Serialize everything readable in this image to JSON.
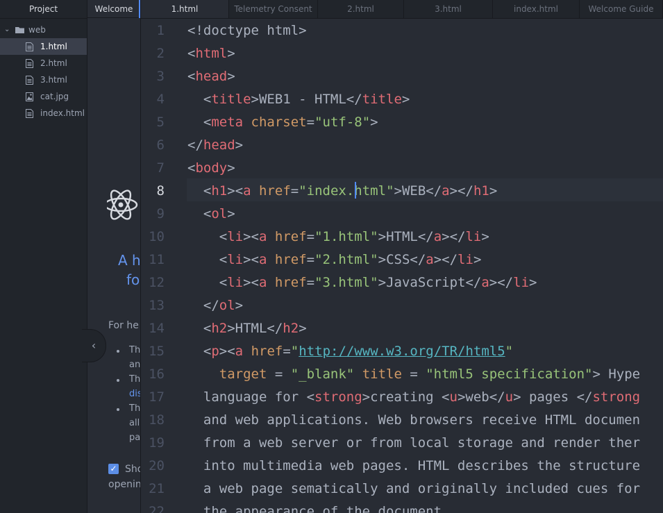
{
  "project": {
    "title": "Project",
    "folder": "web",
    "files": [
      "1.html",
      "2.html",
      "3.html",
      "cat.jpg",
      "index.html"
    ],
    "selected": "1.html"
  },
  "welcome": {
    "tab": "Welcome",
    "heading_1": "A h",
    "heading_2": "fo",
    "help": "For he",
    "items": [
      [
        "Th",
        "an"
      ],
      [
        "Th",
        "dis"
      ],
      [
        "Th",
        "all",
        "pa"
      ]
    ],
    "checkbox_label": "Sho",
    "checkbox_label_2": "openin"
  },
  "tabs": [
    "1.html",
    "Telemetry Consent",
    "2.html",
    "3.html",
    "index.html",
    "Welcome Guide"
  ],
  "active_tab": "1.html",
  "editor": {
    "current_line": 8,
    "lines": [
      [
        [
          "pn",
          "<!doctype html>"
        ]
      ],
      [
        [
          "pn",
          "<"
        ],
        [
          "tg",
          "html"
        ],
        [
          "pn",
          ">"
        ]
      ],
      [
        [
          "pn",
          "<"
        ],
        [
          "tg",
          "head"
        ],
        [
          "pn",
          ">"
        ]
      ],
      [
        [
          "pn",
          "  <"
        ],
        [
          "tg",
          "title"
        ],
        [
          "pn",
          ">WEB1 - HTML</"
        ],
        [
          "tg",
          "title"
        ],
        [
          "pn",
          ">"
        ]
      ],
      [
        [
          "pn",
          "  <"
        ],
        [
          "tg",
          "meta"
        ],
        [
          "pn",
          " "
        ],
        [
          "at",
          "charset"
        ],
        [
          "pn",
          "="
        ],
        [
          "st",
          "\"utf-8\""
        ],
        [
          "pn",
          ">"
        ]
      ],
      [
        [
          "pn",
          "</"
        ],
        [
          "tg",
          "head"
        ],
        [
          "pn",
          ">"
        ]
      ],
      [
        [
          "pn",
          "<"
        ],
        [
          "tg",
          "body"
        ],
        [
          "pn",
          ">"
        ]
      ],
      [
        [
          "pn",
          "  <"
        ],
        [
          "tg",
          "h1"
        ],
        [
          "pn",
          "><"
        ],
        [
          "tg",
          "a"
        ],
        [
          "pn",
          " "
        ],
        [
          "at",
          "href"
        ],
        [
          "pn",
          "="
        ],
        [
          "st",
          "\"index.html\""
        ],
        [
          "pn",
          ">WEB</"
        ],
        [
          "tg",
          "a"
        ],
        [
          "pn",
          "></"
        ],
        [
          "tg",
          "h1"
        ],
        [
          "pn",
          ">"
        ]
      ],
      [
        [
          "pn",
          "  <"
        ],
        [
          "tg",
          "ol"
        ],
        [
          "pn",
          ">"
        ]
      ],
      [
        [
          "pn",
          "    <"
        ],
        [
          "tg",
          "li"
        ],
        [
          "pn",
          "><"
        ],
        [
          "tg",
          "a"
        ],
        [
          "pn",
          " "
        ],
        [
          "at",
          "href"
        ],
        [
          "pn",
          "="
        ],
        [
          "st",
          "\"1.html\""
        ],
        [
          "pn",
          ">HTML</"
        ],
        [
          "tg",
          "a"
        ],
        [
          "pn",
          "></"
        ],
        [
          "tg",
          "li"
        ],
        [
          "pn",
          ">"
        ]
      ],
      [
        [
          "pn",
          "    <"
        ],
        [
          "tg",
          "li"
        ],
        [
          "pn",
          "><"
        ],
        [
          "tg",
          "a"
        ],
        [
          "pn",
          " "
        ],
        [
          "at",
          "href"
        ],
        [
          "pn",
          "="
        ],
        [
          "st",
          "\"2.html\""
        ],
        [
          "pn",
          ">CSS</"
        ],
        [
          "tg",
          "a"
        ],
        [
          "pn",
          "></"
        ],
        [
          "tg",
          "li"
        ],
        [
          "pn",
          ">"
        ]
      ],
      [
        [
          "pn",
          "    <"
        ],
        [
          "tg",
          "li"
        ],
        [
          "pn",
          "><"
        ],
        [
          "tg",
          "a"
        ],
        [
          "pn",
          " "
        ],
        [
          "at",
          "href"
        ],
        [
          "pn",
          "="
        ],
        [
          "st",
          "\"3.html\""
        ],
        [
          "pn",
          ">JavaScript</"
        ],
        [
          "tg",
          "a"
        ],
        [
          "pn",
          "></"
        ],
        [
          "tg",
          "li"
        ],
        [
          "pn",
          ">"
        ]
      ],
      [
        [
          "pn",
          "  </"
        ],
        [
          "tg",
          "ol"
        ],
        [
          "pn",
          ">"
        ]
      ],
      [
        [
          "pn",
          "  <"
        ],
        [
          "tg",
          "h2"
        ],
        [
          "pn",
          ">HTML</"
        ],
        [
          "tg",
          "h2"
        ],
        [
          "pn",
          ">"
        ]
      ],
      [
        [
          "pn",
          "  <"
        ],
        [
          "tg",
          "p"
        ],
        [
          "pn",
          "><"
        ],
        [
          "tg",
          "a"
        ],
        [
          "pn",
          " "
        ],
        [
          "at",
          "href"
        ],
        [
          "pn",
          "="
        ],
        [
          "st",
          "\""
        ],
        [
          "ul",
          "http://www.w3.org/TR/html5"
        ],
        [
          "st",
          "\""
        ]
      ],
      [
        [
          "pn",
          "    "
        ],
        [
          "at",
          "target"
        ],
        [
          "pn",
          " = "
        ],
        [
          "st",
          "\"_blank\""
        ],
        [
          "pn",
          " "
        ],
        [
          "at",
          "title"
        ],
        [
          "pn",
          " = "
        ],
        [
          "st",
          "\"html5 specification\""
        ],
        [
          "pn",
          "> Hype"
        ]
      ],
      [
        [
          "pn",
          "  language for <"
        ],
        [
          "tg",
          "strong"
        ],
        [
          "pn",
          ">creating <"
        ],
        [
          "tg",
          "u"
        ],
        [
          "pn",
          ">web</"
        ],
        [
          "tg",
          "u"
        ],
        [
          "pn",
          "> pages </"
        ],
        [
          "tg",
          "strong"
        ]
      ],
      [
        [
          "pn",
          "  and web applications. Web browsers receive HTML documen"
        ]
      ],
      [
        [
          "pn",
          "  from a web server or from local storage and render ther"
        ]
      ],
      [
        [
          "pn",
          "  into multimedia web pages. HTML describes the structure"
        ]
      ],
      [
        [
          "pn",
          "  a web page sematically and originally included cues for"
        ]
      ],
      [
        [
          "pn",
          "  the appearance of the document."
        ]
      ]
    ]
  }
}
